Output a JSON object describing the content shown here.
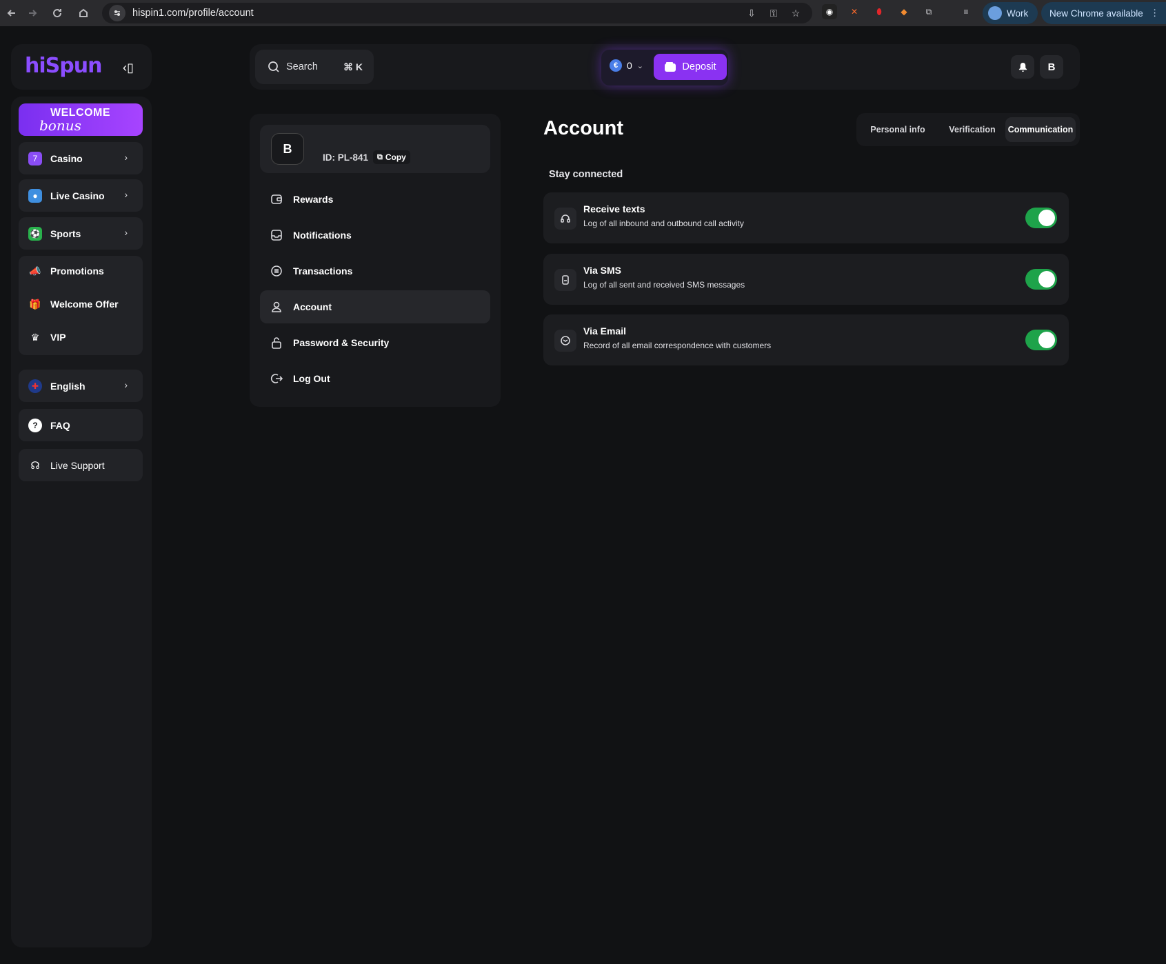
{
  "browser": {
    "url": "hispin1.com/profile/account",
    "profile_label": "Work",
    "update_label": "New Chrome available"
  },
  "sidebar": {
    "logo": "hiSpun",
    "welcome_banner": {
      "line1": "WELCOME",
      "line2": "bonus"
    },
    "nav_items": [
      {
        "label": "Casino",
        "icon": "casino-icon"
      },
      {
        "label": "Live Casino",
        "icon": "live-casino-icon"
      },
      {
        "label": "Sports",
        "icon": "sports-icon"
      }
    ],
    "group_items": [
      {
        "label": "Promotions",
        "icon": "megaphone-icon"
      },
      {
        "label": "Welcome Offer",
        "icon": "gift-icon"
      },
      {
        "label": "VIP",
        "icon": "crown-icon"
      }
    ],
    "language": "English",
    "faq": "FAQ",
    "live_support": "Live Support"
  },
  "topbar": {
    "search_label": "Search",
    "search_shortcut": "⌘ K",
    "balance": "0",
    "currency_symbol": "€",
    "deposit_label": "Deposit",
    "avatar_initial": "B"
  },
  "profile_menu": {
    "avatar_initial": "B",
    "user_id": "ID: PL-841",
    "copy_label": "Copy",
    "items": [
      {
        "label": "Rewards",
        "icon": "wallet-icon"
      },
      {
        "label": "Notifications",
        "icon": "inbox-icon"
      },
      {
        "label": "Transactions",
        "icon": "list-icon"
      },
      {
        "label": "Account",
        "icon": "user-icon"
      },
      {
        "label": "Password & Security",
        "icon": "lock-icon"
      },
      {
        "label": "Log Out",
        "icon": "logout-icon"
      }
    ],
    "active_item": "Account"
  },
  "account": {
    "title": "Account",
    "tabs": [
      "Personal info",
      "Verification",
      "Communication"
    ],
    "active_tab": "Communication",
    "section_label": "Stay connected",
    "preferences": [
      {
        "title": "Receive texts",
        "description": "Log of all inbound and outbound call activity",
        "enabled": true,
        "icon": "headset-icon"
      },
      {
        "title": "Via SMS",
        "description": "Log of all sent and received SMS messages",
        "enabled": true,
        "icon": "phone-icon"
      },
      {
        "title": "Via Email",
        "description": "Record of all email correspondence with customers",
        "enabled": true,
        "icon": "mail-icon"
      }
    ]
  },
  "colors": {
    "accent": "#8a32f2",
    "toggle_on": "#1ea34a",
    "background": "#111214",
    "panel": "#18191c"
  }
}
